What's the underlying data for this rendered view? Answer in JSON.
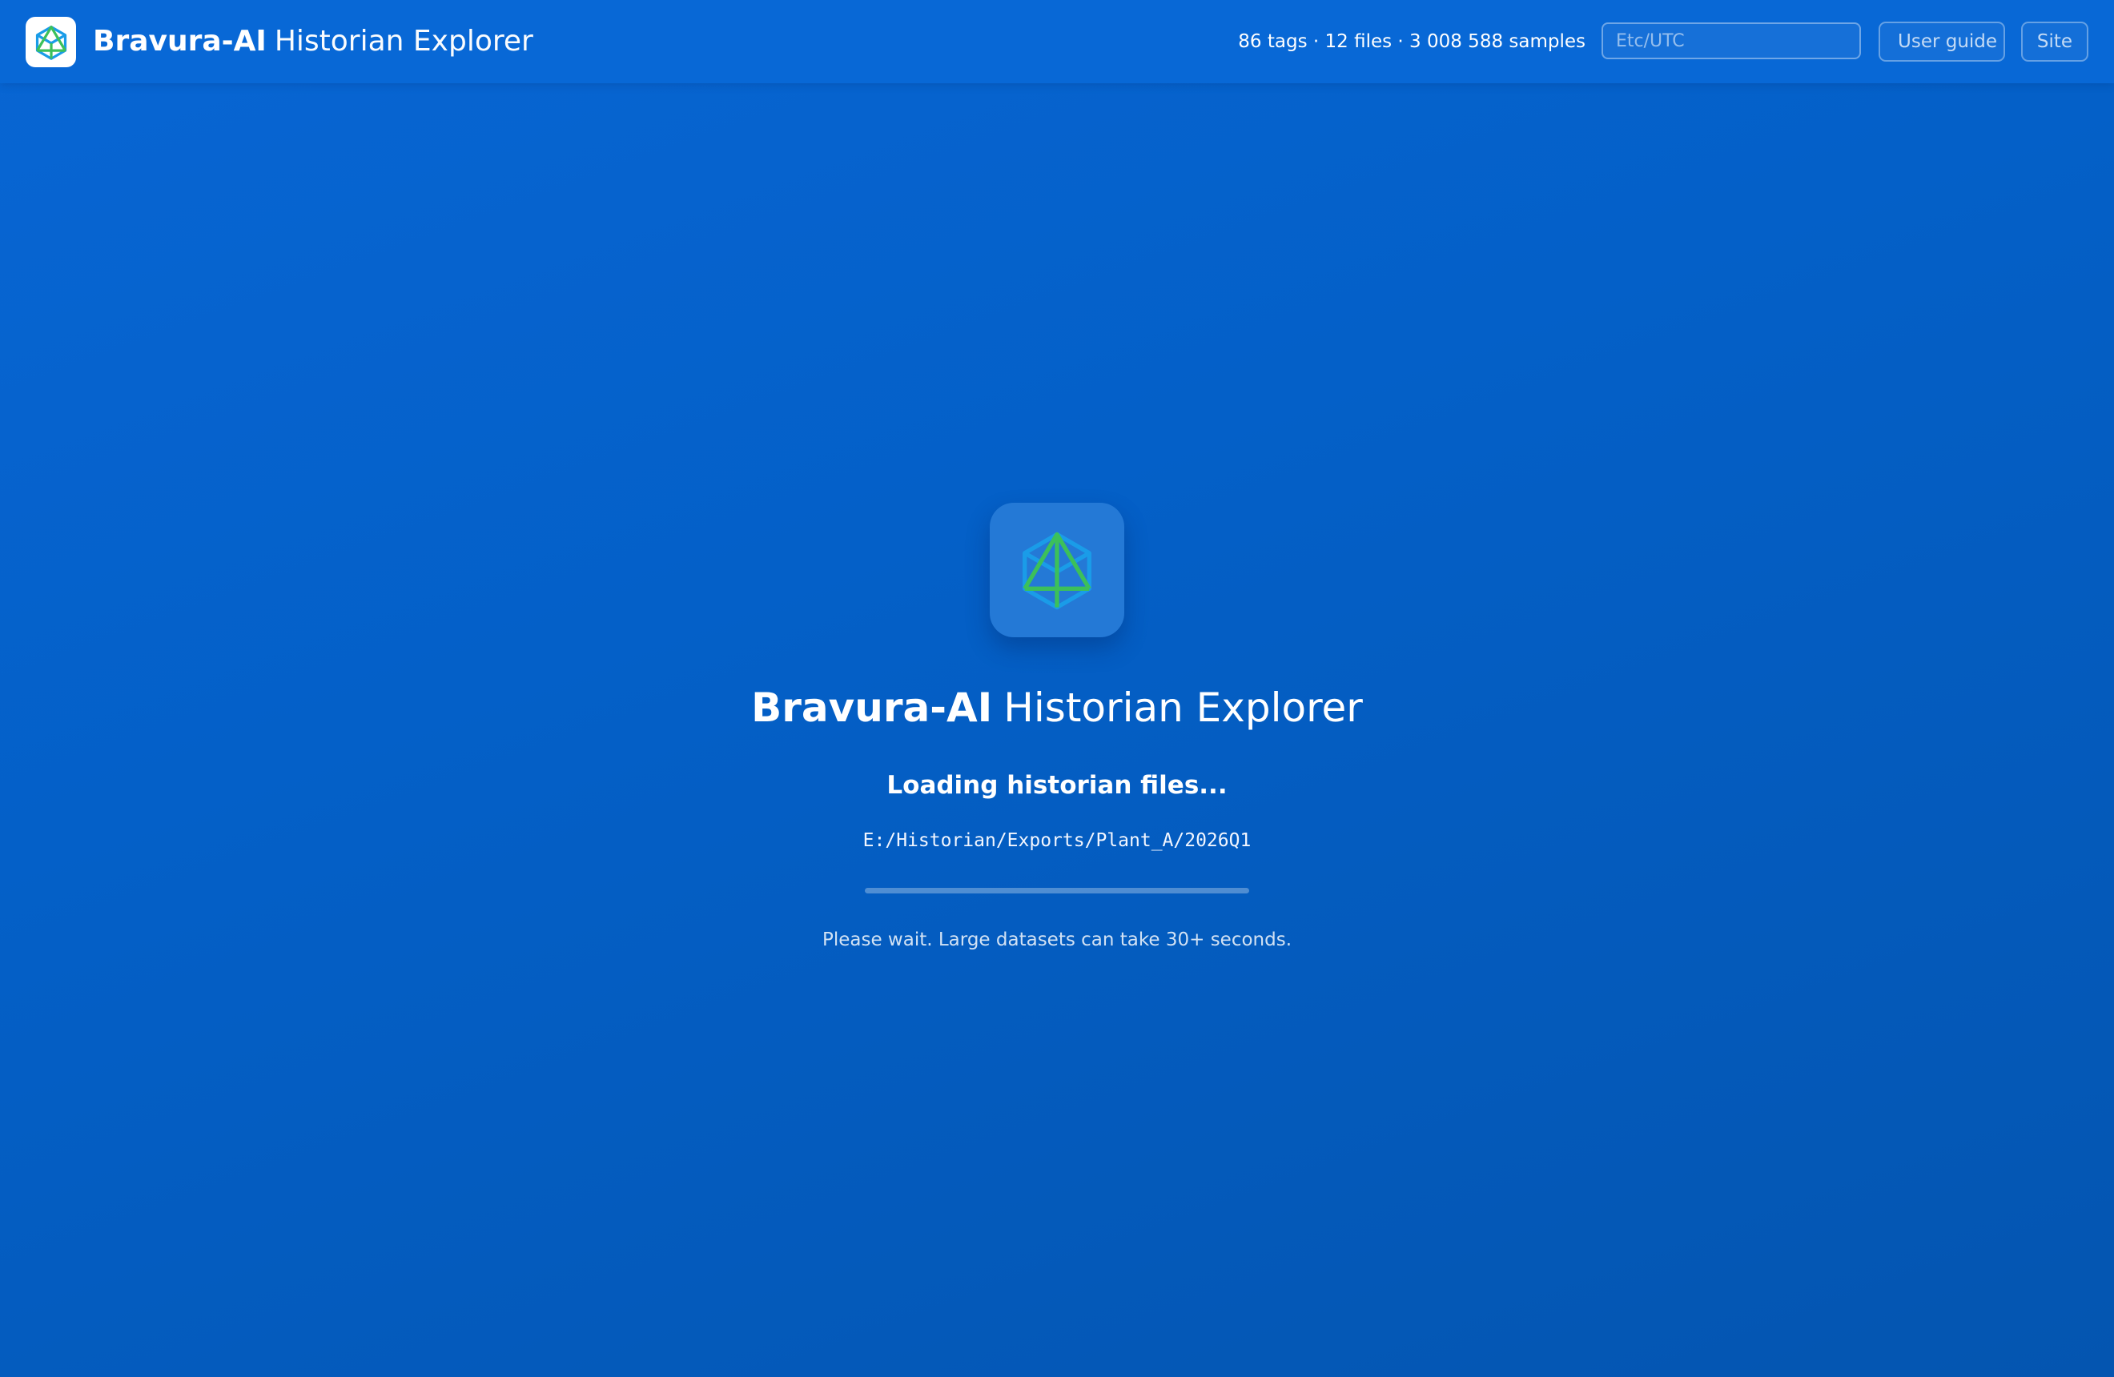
{
  "header": {
    "brand_bold": "Bravura-AI",
    "brand_light": "Historian Explorer",
    "stats": "86 tags · 12 files · 3 008 588 samples",
    "timezone_placeholder": "Etc/UTC",
    "user_guide_label": "User guide",
    "site_label": "Site",
    "logo_icon": "bravura-cube-icon"
  },
  "loader": {
    "title_bold": "Bravura-AI",
    "title_light": "Historian Explorer",
    "status": "Loading historian files...",
    "path": "E:/Historian/Exports/Plant_A/2026Q1",
    "hint": "Please wait. Large datasets can take 30+ seconds.",
    "progress_fraction": 0,
    "app_icon": "bravura-cube-icon"
  },
  "colors": {
    "background": "#0460c8",
    "header": "#0868d6",
    "icon_tile": "#2479d6",
    "logo_green": "#3cc05a",
    "logo_blue": "#1a9ce8"
  }
}
